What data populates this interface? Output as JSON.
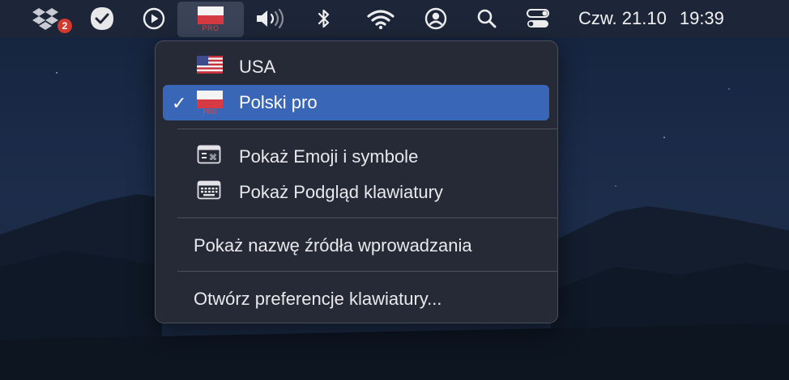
{
  "menubar": {
    "dropbox_badge": "2",
    "input_source_badge": "PRO",
    "clock_date": "Czw. 21.10",
    "clock_time": "19:39"
  },
  "input_menu": {
    "sources": [
      {
        "label": "USA",
        "flag": "us-flag",
        "selected": false
      },
      {
        "label": "Polski pro",
        "flag": "pl-flag",
        "selected": true,
        "flag_badge": "PRO"
      }
    ],
    "check_mark": "✓",
    "tools": [
      {
        "label": "Pokaż Emoji i symbole",
        "icon": "emoji-viewer-icon"
      },
      {
        "label": "Pokaż Podgląd klawiatury",
        "icon": "keyboard-viewer-icon"
      }
    ],
    "show_input_source_name": "Pokaż nazwę źródła wprowadzania",
    "open_preferences": "Otwórz preferencje klawiatury..."
  },
  "colors": {
    "menubar_bg": "#1d2638",
    "menu_bg": "#252a36",
    "selection": "#3a66b7",
    "badge": "#d23a2f"
  }
}
